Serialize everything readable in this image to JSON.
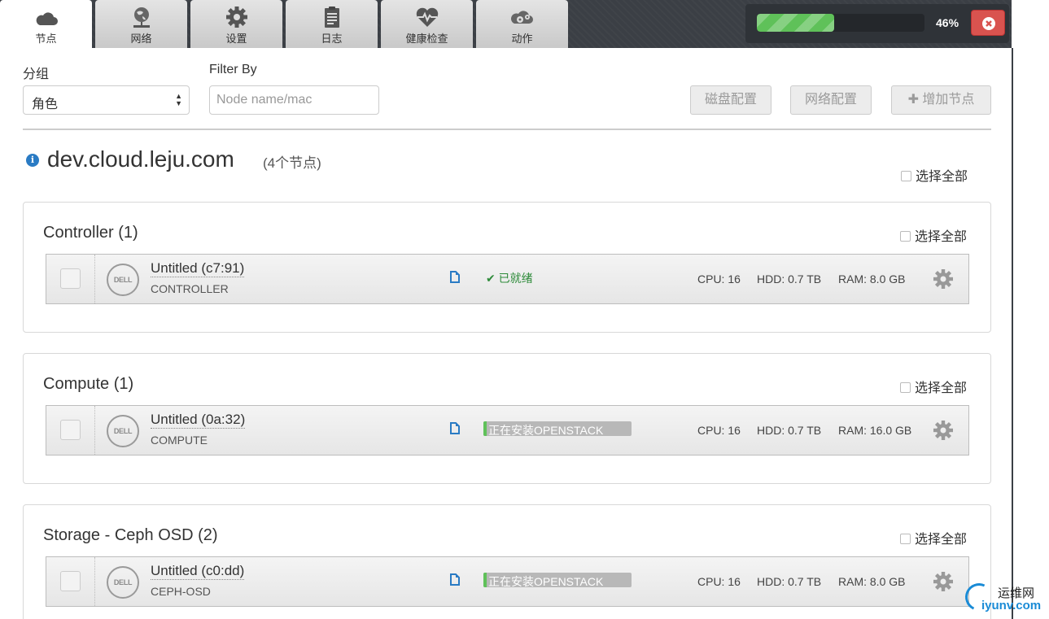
{
  "tabs": [
    {
      "label": "节点",
      "icon": "cloud-icon",
      "active": true
    },
    {
      "label": "网络",
      "icon": "network-globe-icon",
      "active": false
    },
    {
      "label": "设置",
      "icon": "gear-icon",
      "active": false
    },
    {
      "label": "日志",
      "icon": "clipboard-icon",
      "active": false
    },
    {
      "label": "健康检查",
      "icon": "heartbeat-icon",
      "active": false
    },
    {
      "label": "动作",
      "icon": "cogs-cloud-icon",
      "active": false
    }
  ],
  "progress": {
    "percent_text": "46%",
    "value": 0.46
  },
  "controls": {
    "group_label": "分组",
    "group_value": "角色",
    "filter_label": "Filter By",
    "filter_placeholder": "Node name/mac",
    "disk_config": "磁盘配置",
    "network_config": "网络配置",
    "add_node": "增加节点"
  },
  "environment": {
    "name": "dev.cloud.leju.com",
    "count": "(4个节点)",
    "select_all": "选择全部"
  },
  "groups": [
    {
      "title": "Controller (1)",
      "select_all": "选择全部",
      "nodes": [
        {
          "name": "Untitled (c7:91)",
          "role": "CONTROLLER",
          "status": "已就绪",
          "status_type": "ready",
          "cpu": "CPU: 16",
          "hdd": "HDD: 0.7 TB",
          "ram": "RAM: 8.0 GB",
          "vendor": "DELL"
        }
      ]
    },
    {
      "title": "Compute (1)",
      "select_all": "选择全部",
      "nodes": [
        {
          "name": "Untitled (0a:32)",
          "role": "COMPUTE",
          "status": "正在安装OPENSTACK",
          "status_type": "installing",
          "progress": 0.02,
          "cpu": "CPU: 16",
          "hdd": "HDD: 0.7 TB",
          "ram": "RAM: 16.0 GB",
          "vendor": "DELL"
        }
      ]
    },
    {
      "title": "Storage - Ceph OSD (2)",
      "select_all": "选择全部",
      "nodes": [
        {
          "name": "Untitled (c0:dd)",
          "role": "CEPH-OSD",
          "status": "正在安装OPENSTACK",
          "status_type": "installing",
          "progress": 0.02,
          "cpu": "CPU: 16",
          "hdd": "HDD: 0.7 TB",
          "ram": "RAM: 8.0 GB",
          "vendor": "DELL"
        }
      ]
    }
  ],
  "watermark": {
    "top": "运维网",
    "bottom": "iyunv.com"
  },
  "colors": {
    "accent": "#2a7bc4",
    "success": "#5fc159",
    "danger": "#d9534f",
    "topbar": "#3b3f45"
  }
}
